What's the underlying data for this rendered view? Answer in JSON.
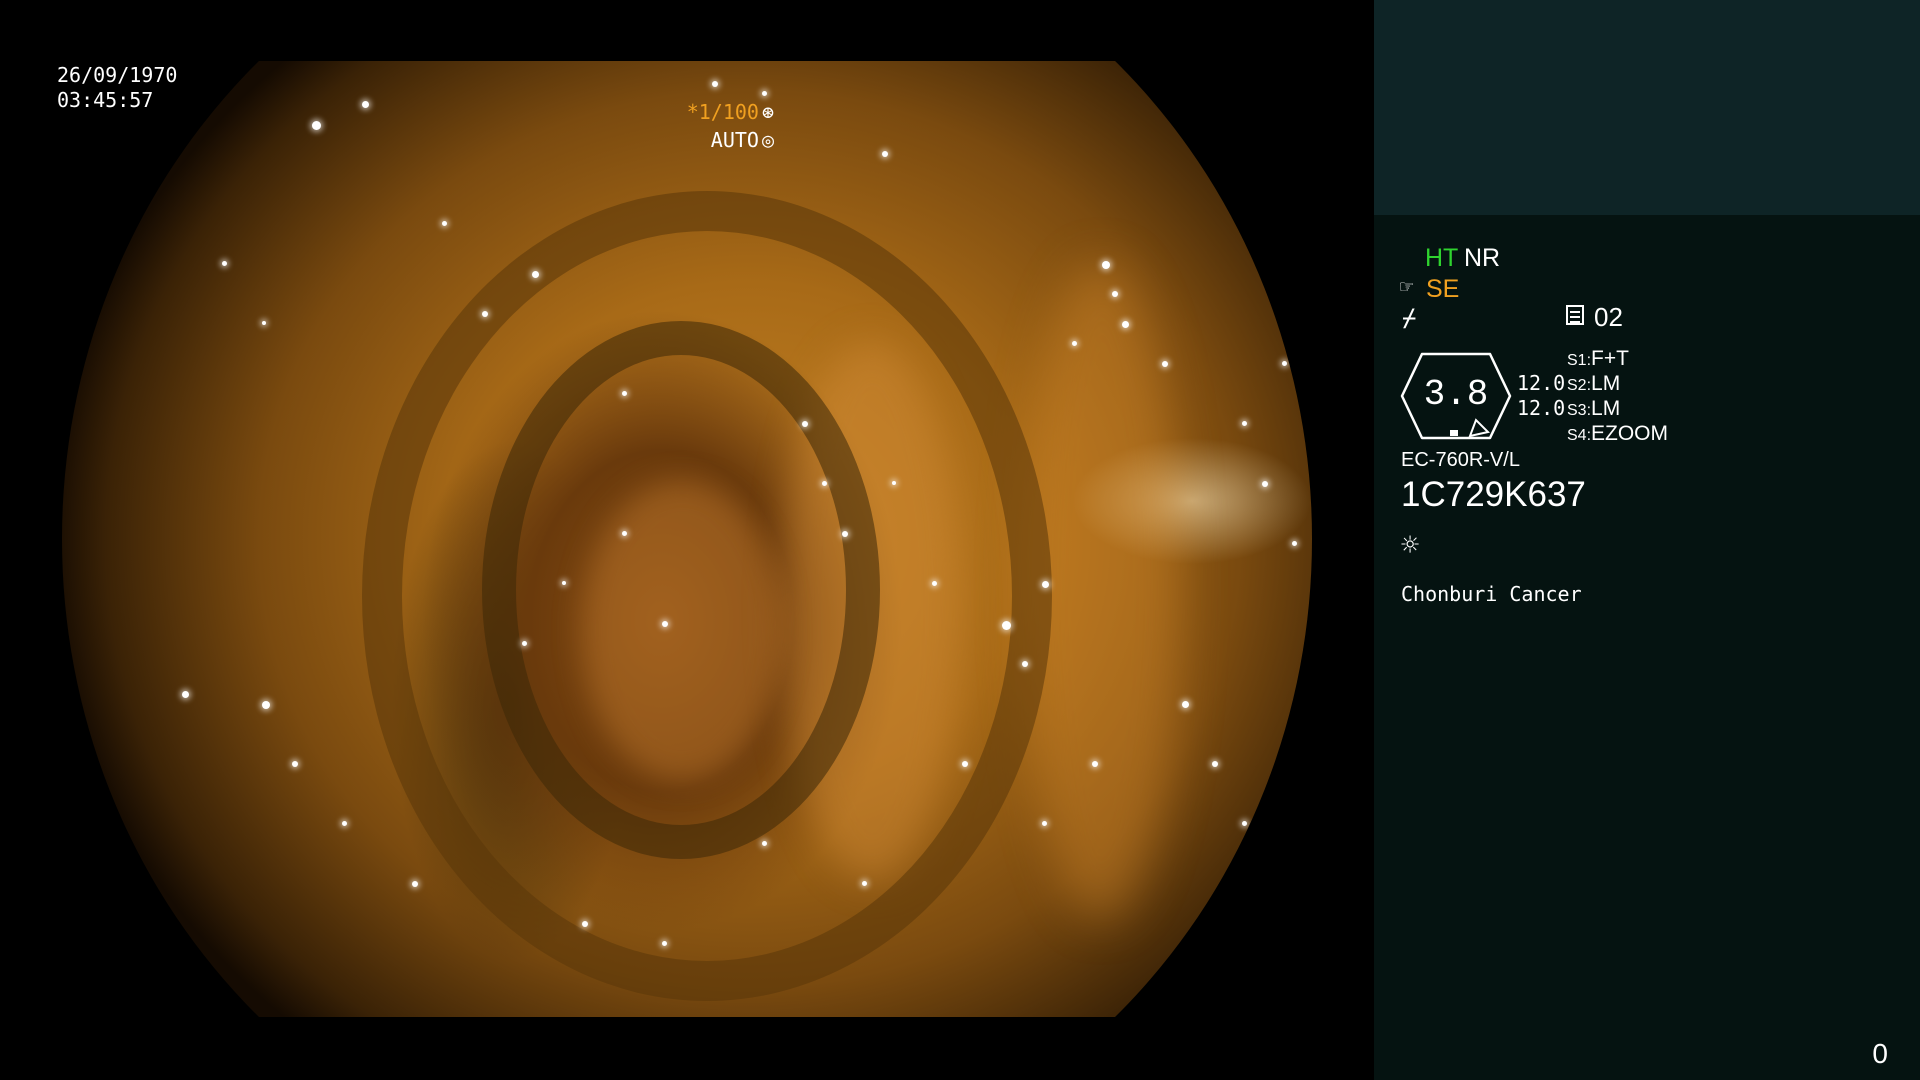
{
  "overlay": {
    "date": "26/09/1970",
    "time": "03:45:57",
    "shutter": "*1/100",
    "shutter_icon": "⊛",
    "iris": "AUTO",
    "iris_icon": "◎"
  },
  "panel": {
    "mode_ht": "HT",
    "mode_nr": "NR",
    "structure": "SE",
    "memo_value": "02",
    "gauge_value": "3.8",
    "value_1": "12.0",
    "value_2": "12.0",
    "slots": [
      {
        "key": "S1:",
        "value": "F+T"
      },
      {
        "key": "S2:",
        "value": "LM"
      },
      {
        "key": "S3:",
        "value": "LM"
      },
      {
        "key": "S4:",
        "value": "EZOOM"
      }
    ],
    "scope_model": "EC-760R-V/L",
    "scope_serial": "1C729K637",
    "hospital": "Chonburi Cancer",
    "counter": "0"
  },
  "colors": {
    "highlight_green": "#2fd32f",
    "highlight_orange": "#f0a020",
    "panel_top": "#0e2426",
    "panel_body": "#051311"
  },
  "icons": [
    "hand-icon",
    "bolt-icon",
    "memo-icon",
    "sun-icon",
    "shutter-icon",
    "iris-icon"
  ]
}
